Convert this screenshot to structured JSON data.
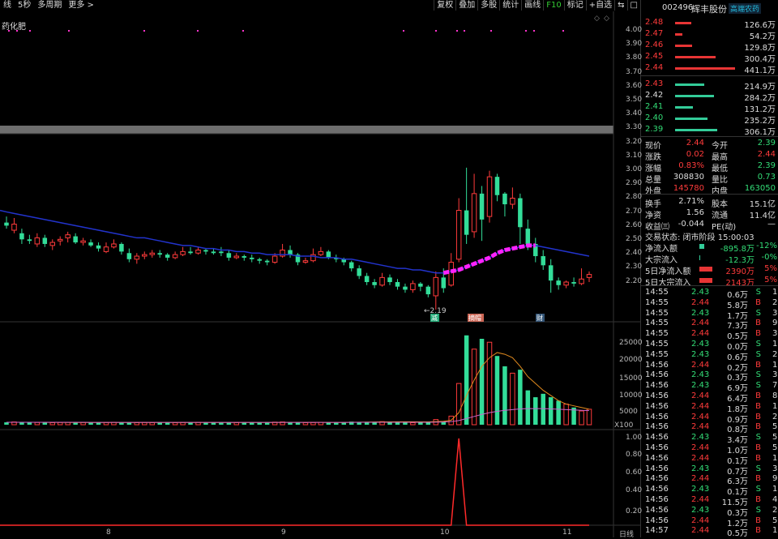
{
  "topbar": {
    "left": [
      "线",
      "5秒",
      "多周期",
      "更多 >"
    ],
    "right": [
      "复权",
      "叠加",
      "多股",
      "统计",
      "画线",
      "F10",
      "标记",
      "+自选",
      "⇆",
      "□"
    ]
  },
  "indicator_label": "药化肥",
  "price_axis": [
    "4.00",
    "3.90",
    "3.80",
    "3.70",
    "3.60",
    "3.50",
    "3.40",
    "3.30",
    "3.20",
    "3.10",
    "3.00",
    "2.90",
    "2.80",
    "2.70",
    "2.60",
    "2.50",
    "2.40",
    "2.30",
    "2.20"
  ],
  "volume_axis": [
    "25000",
    "20000",
    "15000",
    "10000",
    "5000",
    "X100"
  ],
  "bottom_axis": [
    "1.00",
    "0.80",
    "0.60",
    "0.40",
    "0.20"
  ],
  "date_axis": [
    "8",
    "9",
    "10",
    "11"
  ],
  "period_label": "日线",
  "annotations": {
    "low_label": "←2.19",
    "tag1": "减",
    "tag2": "摘帽",
    "tag3": "财"
  },
  "colors": {
    "up": "#ff3b3b",
    "down": "#33dd99",
    "ma": "#2233cc",
    "ma_hl": "#ff22ff",
    "vol_ma1": "#e08a1e",
    "vol_ma2": "#cc66cc",
    "signal": "#ff2a2a"
  },
  "chart_data": {
    "type": "candlestick",
    "candles": [
      [
        2.76,
        2.74,
        2.8,
        2.72
      ],
      [
        2.71,
        2.75,
        2.79,
        2.69
      ],
      [
        2.69,
        2.65,
        2.72,
        2.62
      ],
      [
        2.65,
        2.64,
        2.68,
        2.62
      ],
      [
        2.62,
        2.66,
        2.69,
        2.6
      ],
      [
        2.66,
        2.62,
        2.68,
        2.6
      ],
      [
        2.61,
        2.63,
        2.65,
        2.58
      ],
      [
        2.64,
        2.65,
        2.67,
        2.61
      ],
      [
        2.66,
        2.68,
        2.7,
        2.63
      ],
      [
        2.67,
        2.63,
        2.69,
        2.62
      ],
      [
        2.63,
        2.64,
        2.66,
        2.61
      ],
      [
        2.63,
        2.61,
        2.65,
        2.6
      ],
      [
        2.61,
        2.59,
        2.63,
        2.57
      ],
      [
        2.57,
        2.6,
        2.63,
        2.56
      ],
      [
        2.6,
        2.62,
        2.65,
        2.59
      ],
      [
        2.62,
        2.57,
        2.63,
        2.55
      ],
      [
        2.56,
        2.52,
        2.59,
        2.5
      ],
      [
        2.52,
        2.54,
        2.56,
        2.49
      ],
      [
        2.54,
        2.55,
        2.57,
        2.52
      ],
      [
        2.55,
        2.56,
        2.58,
        2.53
      ],
      [
        2.56,
        2.55,
        2.58,
        2.53
      ],
      [
        2.55,
        2.53,
        2.56,
        2.51
      ],
      [
        2.53,
        2.55,
        2.57,
        2.52
      ],
      [
        2.55,
        2.57,
        2.6,
        2.54
      ],
      [
        2.57,
        2.56,
        2.6,
        2.55
      ],
      [
        2.56,
        2.58,
        2.6,
        2.55
      ],
      [
        2.58,
        2.57,
        2.59,
        2.55
      ],
      [
        2.57,
        2.56,
        2.59,
        2.55
      ],
      [
        2.57,
        2.56,
        2.6,
        2.54
      ],
      [
        2.56,
        2.53,
        2.58,
        2.51
      ],
      [
        2.53,
        2.54,
        2.56,
        2.52
      ],
      [
        2.54,
        2.53,
        2.55,
        2.51
      ],
      [
        2.53,
        2.52,
        2.55,
        2.5
      ],
      [
        2.52,
        2.51,
        2.53,
        2.49
      ],
      [
        2.51,
        2.5,
        2.52,
        2.48
      ],
      [
        2.5,
        2.54,
        2.56,
        2.49
      ],
      [
        2.54,
        2.58,
        2.62,
        2.53
      ],
      [
        2.58,
        2.55,
        2.61,
        2.53
      ],
      [
        2.55,
        2.5,
        2.56,
        2.48
      ],
      [
        2.5,
        2.51,
        2.53,
        2.49
      ],
      [
        2.51,
        2.55,
        2.59,
        2.5
      ],
      [
        2.55,
        2.57,
        2.6,
        2.54
      ],
      [
        2.57,
        2.53,
        2.58,
        2.52
      ],
      [
        2.53,
        2.52,
        2.55,
        2.5
      ],
      [
        2.52,
        2.5,
        2.53,
        2.48
      ],
      [
        2.5,
        2.46,
        2.51,
        2.44
      ],
      [
        2.46,
        2.41,
        2.48,
        2.39
      ],
      [
        2.41,
        2.37,
        2.43,
        2.35
      ],
      [
        2.37,
        2.35,
        2.39,
        2.33
      ],
      [
        2.35,
        2.4,
        2.43,
        2.34
      ],
      [
        2.4,
        2.37,
        2.42,
        2.35
      ],
      [
        2.37,
        2.34,
        2.39,
        2.32
      ],
      [
        2.34,
        2.32,
        2.36,
        2.3
      ],
      [
        2.32,
        2.36,
        2.38,
        2.3
      ],
      [
        2.36,
        2.34,
        2.37,
        2.31
      ],
      [
        2.34,
        2.29,
        2.35,
        2.27
      ],
      [
        2.28,
        2.4,
        2.44,
        2.19
      ],
      [
        2.4,
        2.33,
        2.46,
        2.3
      ],
      [
        2.35,
        2.5,
        2.56,
        2.34
      ],
      [
        2.52,
        2.84,
        2.92,
        2.5
      ],
      [
        2.84,
        2.68,
        3.12,
        2.62
      ],
      [
        2.7,
        2.95,
        3.08,
        2.66
      ],
      [
        2.95,
        2.78,
        3.0,
        2.64
      ],
      [
        2.8,
        3.06,
        3.1,
        2.76
      ],
      [
        3.06,
        2.94,
        3.08,
        2.9
      ],
      [
        2.95,
        2.88,
        2.96,
        2.8
      ],
      [
        2.88,
        2.92,
        2.99,
        2.85
      ],
      [
        2.92,
        2.73,
        2.95,
        2.62
      ],
      [
        2.72,
        2.62,
        2.78,
        2.58
      ],
      [
        2.62,
        2.54,
        2.66,
        2.5
      ],
      [
        2.54,
        2.48,
        2.58,
        2.45
      ],
      [
        2.48,
        2.38,
        2.52,
        2.3
      ],
      [
        2.38,
        2.35,
        2.4,
        2.32
      ],
      [
        2.35,
        2.37,
        2.38,
        2.33
      ],
      [
        2.37,
        2.36,
        2.4,
        2.34
      ],
      [
        2.36,
        2.39,
        2.46,
        2.35
      ],
      [
        2.4,
        2.42,
        2.44,
        2.37
      ]
    ],
    "ma": [
      2.83,
      2.82,
      2.81,
      2.8,
      2.79,
      2.78,
      2.77,
      2.76,
      2.75,
      2.74,
      2.73,
      2.72,
      2.71,
      2.7,
      2.69,
      2.68,
      2.67,
      2.66,
      2.66,
      2.65,
      2.64,
      2.63,
      2.62,
      2.61,
      2.61,
      2.6,
      2.59,
      2.59,
      2.58,
      2.58,
      2.57,
      2.57,
      2.56,
      2.56,
      2.55,
      2.55,
      2.55,
      2.55,
      2.54,
      2.54,
      2.54,
      2.53,
      2.53,
      2.53,
      2.52,
      2.52,
      2.51,
      2.5,
      2.49,
      2.48,
      2.47,
      2.46,
      2.46,
      2.45,
      2.45,
      2.44,
      2.43,
      2.43,
      2.44,
      2.45,
      2.47,
      2.49,
      2.51,
      2.53,
      2.56,
      2.58,
      2.59,
      2.6,
      2.61,
      2.61,
      2.6,
      2.59,
      2.58,
      2.57,
      2.56,
      2.55,
      2.54
    ],
    "ma_highlight_range": [
      57,
      69
    ],
    "volume": [
      700,
      800,
      600,
      700,
      650,
      700,
      600,
      650,
      700,
      600,
      650,
      700,
      600,
      650,
      700,
      620,
      680,
      600,
      650,
      600,
      620,
      700,
      600,
      650,
      620,
      680,
      700,
      620,
      600,
      650,
      620,
      680,
      600,
      650,
      700,
      750,
      800,
      700,
      650,
      600,
      640,
      700,
      600,
      650,
      700,
      900,
      800,
      700,
      800,
      900,
      700,
      650,
      700,
      600,
      650,
      800,
      1500,
      900,
      2500,
      12000,
      26000,
      22000,
      25000,
      24000,
      20000,
      17000,
      15000,
      16000,
      10000,
      8000,
      9000,
      8000,
      7000,
      6000,
      5000,
      4000,
      4500
    ],
    "vol_ma1": [
      null,
      null,
      null,
      null,
      700,
      690,
      680,
      670,
      660,
      660,
      650,
      650,
      650,
      650,
      650,
      650,
      650,
      640,
      640,
      640,
      640,
      640,
      640,
      640,
      640,
      640,
      650,
      650,
      650,
      650,
      650,
      640,
      640,
      640,
      650,
      660,
      670,
      680,
      690,
      690,
      680,
      670,
      660,
      650,
      650,
      700,
      740,
      770,
      800,
      820,
      840,
      850,
      860,
      850,
      840,
      820,
      900,
      1000,
      1300,
      3500,
      8500,
      13000,
      17000,
      19500,
      21000,
      20500,
      19500,
      17000,
      14000,
      12000,
      10000,
      8500,
      7000,
      6000,
      5500,
      5000,
      4500
    ],
    "vol_ma2": [
      700,
      700,
      700,
      700,
      700,
      700,
      700,
      700,
      700,
      700,
      700,
      690,
      690,
      690,
      690,
      690,
      690,
      690,
      690,
      690,
      690,
      690,
      690,
      690,
      690,
      690,
      690,
      690,
      690,
      690,
      690,
      690,
      690,
      690,
      690,
      690,
      690,
      690,
      690,
      690,
      690,
      690,
      690,
      690,
      690,
      690,
      700,
      700,
      700,
      710,
      710,
      710,
      710,
      710,
      710,
      720,
      750,
      800,
      900,
      1200,
      1800,
      2400,
      3000,
      3500,
      3900,
      4200,
      4400,
      4600,
      4700,
      4700,
      4700,
      4600,
      4500,
      4400,
      4300,
      4200,
      4100
    ],
    "signal_peak_index": 59,
    "signal_value": 1.0,
    "price_range": [
      2.15,
      4.05
    ],
    "volume_range": [
      0,
      28000
    ],
    "signal_range": [
      0,
      1.1
    ]
  },
  "sidebar": {
    "code": "002496",
    "name": "辉丰股份",
    "tag": "高端农药",
    "asks": [
      {
        "price": "2.48",
        "vol": "126.6万",
        "bar": 20
      },
      {
        "price": "2.47",
        "vol": "54.2万",
        "bar": 9
      },
      {
        "price": "2.46",
        "vol": "129.8万",
        "bar": 21
      },
      {
        "price": "2.45",
        "vol": "300.4万",
        "bar": 50
      },
      {
        "price": "2.44",
        "vol": "441.1万",
        "bar": 74
      }
    ],
    "bids": [
      {
        "price": "2.43",
        "vol": "214.9万",
        "bar": 36
      },
      {
        "price": "2.42",
        "vol": "284.2万",
        "bar": 48
      },
      {
        "price": "2.41",
        "vol": "131.2万",
        "bar": 22
      },
      {
        "price": "2.40",
        "vol": "235.2万",
        "bar": 40
      },
      {
        "price": "2.39",
        "vol": "306.1万",
        "bar": 52
      }
    ],
    "quote": [
      [
        "现价",
        "2.44",
        "今开",
        "2.39"
      ],
      [
        "涨跌",
        "0.02",
        "最高",
        "2.44"
      ],
      [
        "涨幅",
        "0.83%",
        "最低",
        "2.39"
      ],
      [
        "总量",
        "308830",
        "量比",
        "0.73"
      ],
      [
        "外盘",
        "145780",
        "内盘",
        "163050"
      ],
      [
        "换手",
        "2.71%",
        "股本",
        "15.1亿"
      ],
      [
        "净资",
        "1.56",
        "流通",
        "11.4亿"
      ],
      [
        "收益㈢",
        "-0.044",
        "PE(动)",
        "—"
      ]
    ],
    "status": "交易状态: 闭市阶段 15:00:03",
    "flows": [
      [
        "净流入额",
        "-895.8万",
        "-12%"
      ],
      [
        "大宗流入",
        "-12.3万",
        "-0%"
      ],
      [
        "5日净流入额",
        "2390万",
        "5%"
      ],
      [
        "5日大宗流入",
        "2143万",
        "5%"
      ]
    ],
    "trades": [
      [
        "14:55",
        "2.43",
        "0.6万",
        "S",
        "1"
      ],
      [
        "14:55",
        "2.44",
        "5.8万",
        "B",
        "22"
      ],
      [
        "14:55",
        "2.43",
        "1.7万",
        "S",
        "3"
      ],
      [
        "14:55",
        "2.44",
        "7.3万",
        "B",
        "9"
      ],
      [
        "14:55",
        "2.44",
        "0.5万",
        "B",
        "3"
      ],
      [
        "14:55",
        "2.43",
        "0.0万",
        "S",
        "1"
      ],
      [
        "14:55",
        "2.43",
        "0.6万",
        "S",
        "2"
      ],
      [
        "14:56",
        "2.44",
        "0.2万",
        "B",
        "1"
      ],
      [
        "14:56",
        "2.43",
        "0.3万",
        "S",
        "3"
      ],
      [
        "14:56",
        "2.43",
        "6.9万",
        "S",
        "7"
      ],
      [
        "14:56",
        "2.44",
        "6.4万",
        "B",
        "8"
      ],
      [
        "14:56",
        "2.44",
        "1.8万",
        "B",
        "1"
      ],
      [
        "14:56",
        "2.44",
        "0.9万",
        "B",
        "2"
      ],
      [
        "14:56",
        "2.44",
        "0.8万",
        "B",
        "5"
      ],
      [
        "14:56",
        "2.43",
        "3.4万",
        "S",
        "5"
      ],
      [
        "14:56",
        "2.44",
        "1.0万",
        "B",
        "5"
      ],
      [
        "14:56",
        "2.44",
        "0.1万",
        "B",
        "1"
      ],
      [
        "14:56",
        "2.43",
        "0.7万",
        "S",
        "3"
      ],
      [
        "14:56",
        "2.44",
        "6.3万",
        "B",
        "9"
      ],
      [
        "14:56",
        "2.43",
        "0.1万",
        "S",
        "1"
      ],
      [
        "14:56",
        "2.44",
        "11.5万",
        "B",
        "42"
      ],
      [
        "14:56",
        "2.43",
        "0.3万",
        "S",
        "2"
      ],
      [
        "14:56",
        "2.44",
        "1.2万",
        "B",
        "5"
      ],
      [
        "14:57",
        "2.44",
        "0.5万",
        "B",
        "1"
      ]
    ]
  }
}
